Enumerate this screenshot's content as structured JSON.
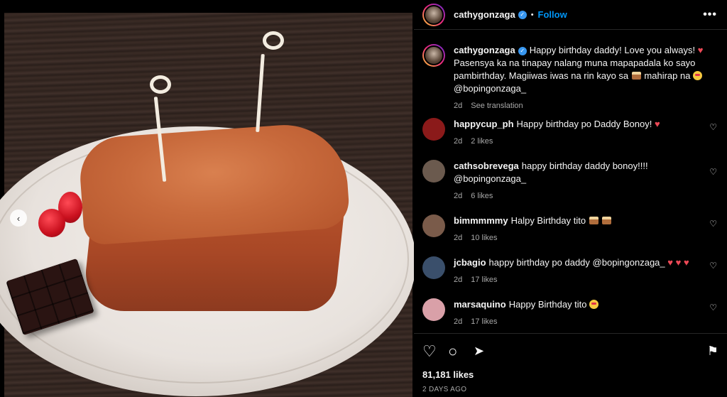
{
  "header": {
    "username": "cathygonzaga",
    "verified_icon": "verified-badge-icon",
    "separator": "•",
    "follow_label": "Follow",
    "more_icon": "•••"
  },
  "photo": {
    "prev_icon": "‹"
  },
  "caption": {
    "username": "cathygonzaga",
    "text_1": "Happy birthday daddy! Love you always!",
    "text_2": "Pasensya ka na tinapay nalang muna mapapadala ko sayo pambirthday. Magiiwas iwas na rin kayo sa",
    "text_3": "mahirap na",
    "mention": "@bopingonzaga_",
    "time": "2d",
    "translate": "See translation"
  },
  "comments": [
    {
      "username": "happycup_ph",
      "text": "Happy birthday po Daddy Bonoy!",
      "time": "2d",
      "likes": "2 likes",
      "avatar_color": "#8b1a1a"
    },
    {
      "username": "cathsobrevega",
      "text": "happy birthday daddy bonoy!!!!",
      "mention": "@bopingonzaga_",
      "time": "2d",
      "likes": "6 likes",
      "avatar_color": "#6b5a4e"
    },
    {
      "username": "bimmmmmy",
      "text": "Halpy Birthday tito",
      "time": "2d",
      "likes": "10 likes",
      "avatar_color": "#7a5b4a"
    },
    {
      "username": "jcbagio",
      "text": "happy birthday po daddy",
      "mention": "@bopingonzaga_",
      "time": "2d",
      "likes": "17 likes",
      "avatar_color": "#3a4f6b"
    },
    {
      "username": "marsaquino",
      "text": "Happy Birthday tito",
      "time": "2d",
      "likes": "17 likes",
      "avatar_color": "#d9a0a8"
    }
  ],
  "actions": {
    "like_icon": "♡",
    "comment_icon": "○",
    "share_icon": "➤",
    "save_icon": "⚑",
    "likes": "81,181 likes",
    "date": "2 DAYS AGO"
  },
  "colors": {
    "accent": "#0095f6",
    "heart": "#ed4956",
    "muted": "#a8a8a8"
  }
}
